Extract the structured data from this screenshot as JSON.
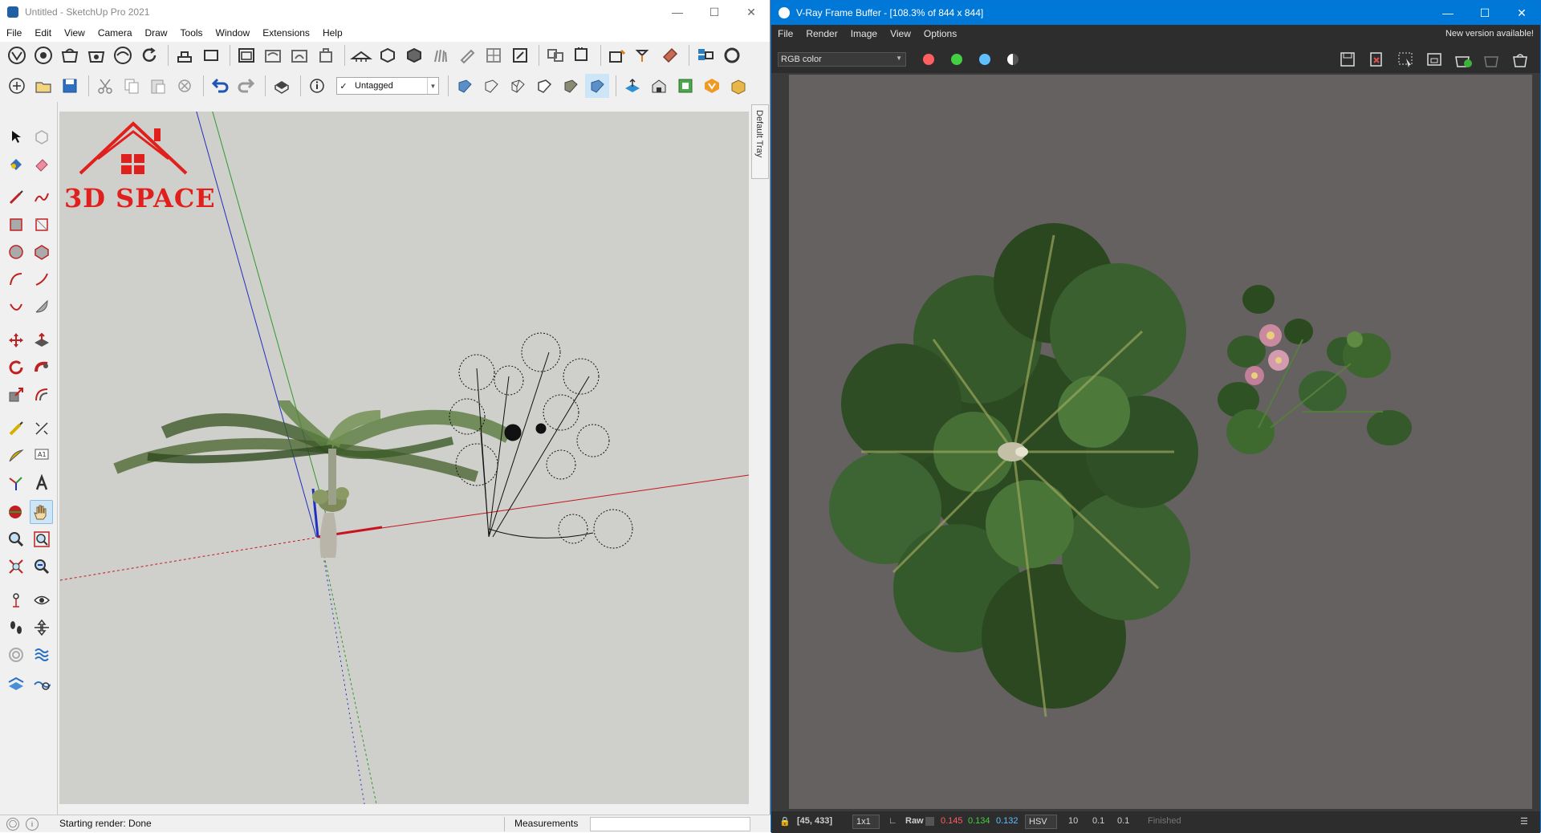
{
  "sketchup": {
    "title": "Untitled - SketchUp Pro 2021",
    "menu": [
      "File",
      "Edit",
      "View",
      "Camera",
      "Draw",
      "Tools",
      "Window",
      "Extensions",
      "Help"
    ],
    "tag_dropdown": {
      "value": "Untagged",
      "check": "✓"
    },
    "tray_label": "Default Tray",
    "logo_text": "3D SPACE",
    "status_text": "Starting render: Done",
    "measurements_label": "Measurements",
    "measurements_value": "",
    "colors": {
      "red_axis": "#c8141e",
      "green_axis": "#2f9a2f",
      "blue_axis": "#2030c0",
      "logo": "#e0201c"
    }
  },
  "vray": {
    "title": "V-Ray Frame Buffer - [108.3% of 844 x 844]",
    "menu": [
      "File",
      "Render",
      "Image",
      "View",
      "Options"
    ],
    "new_version": "New version available!",
    "channel_select": "RGB color",
    "channel_colors": [
      "#ff5f5f",
      "#42d042",
      "#5fbfff"
    ],
    "status": {
      "coords": "[45, 433]",
      "ratio": "1x1",
      "mode": "Raw",
      "r": "0.145",
      "g": "0.134",
      "b": "0.132",
      "colorspace": "HSV",
      "h": "10",
      "s": "0.1",
      "v": "0.1",
      "state": "Finished"
    }
  }
}
